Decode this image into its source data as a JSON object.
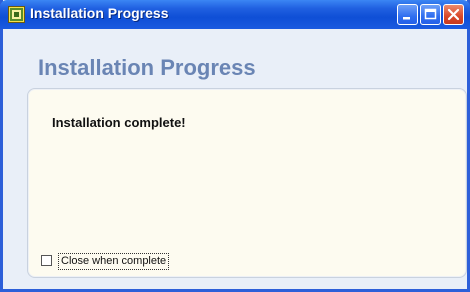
{
  "window": {
    "title": "Installation Progress",
    "controls": [
      "minimize",
      "maximize",
      "close"
    ]
  },
  "page": {
    "heading": "Installation Progress"
  },
  "status": {
    "message": "Installation complete!"
  },
  "options": {
    "close_when_complete_label": "Close when complete",
    "close_when_complete_checked": false
  },
  "icons": {
    "app": "installer-app-icon",
    "minimize": "minimize-icon",
    "maximize": "maximize-icon",
    "close": "close-icon"
  },
  "colors": {
    "titlebar": "#1f5fe0",
    "heading": "#6a85b4",
    "panel_bg": "#fdfbf0",
    "close_button": "#d8482a"
  }
}
